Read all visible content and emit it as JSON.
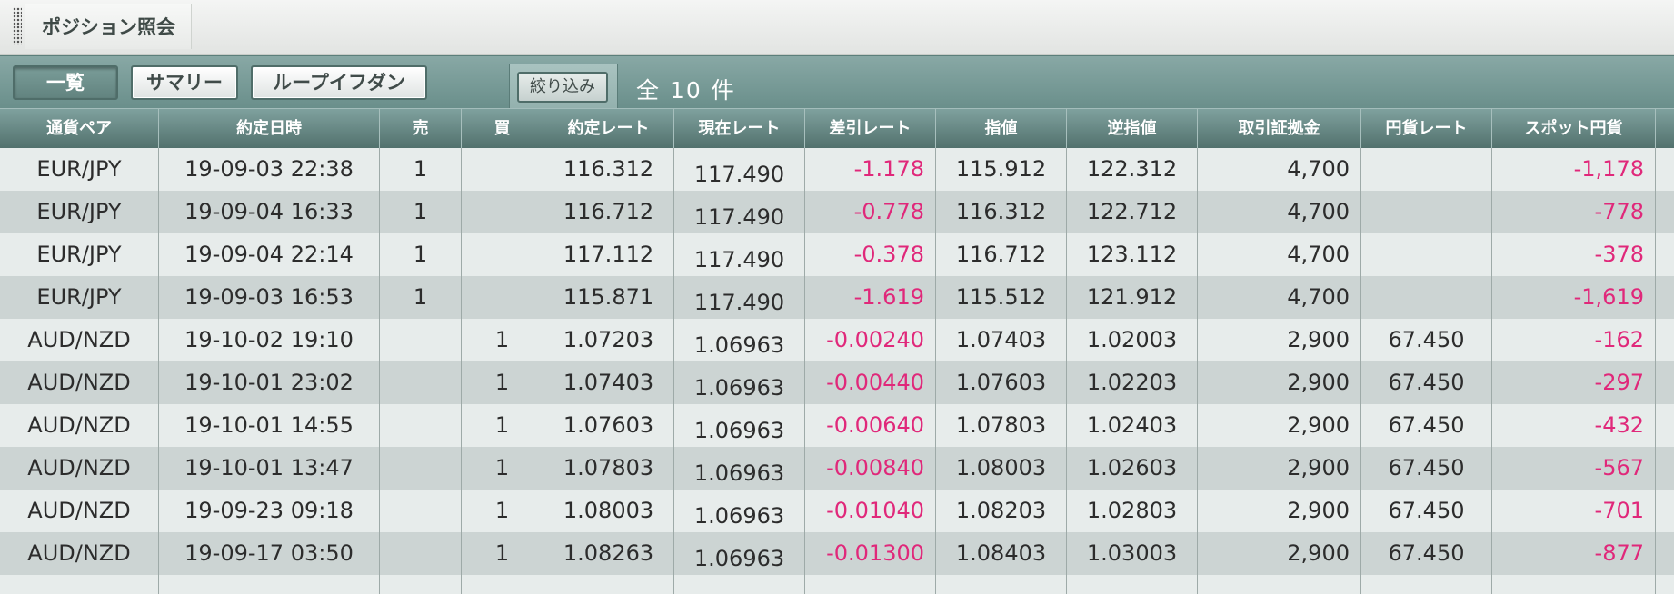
{
  "window": {
    "title": "ポジション照会"
  },
  "toolbar": {
    "buttons": [
      {
        "label": "一覧"
      },
      {
        "label": "サマリー"
      },
      {
        "label": "ループイフダン"
      }
    ],
    "filter_label": "絞り込み",
    "count_label": "全 10 件"
  },
  "table": {
    "columns": [
      "通貨ペア",
      "約定日時",
      "売",
      "買",
      "約定レート",
      "現在レート",
      "差引レート",
      "指値",
      "逆指値",
      "取引証拠金",
      "円貨レート",
      "スポット円貨"
    ],
    "rows": [
      [
        "EUR/JPY",
        "19-09-03 22:38",
        "1",
        "",
        "116.312",
        "117.490",
        "-1.178",
        "115.912",
        "122.312",
        "4,700",
        "",
        "-1,178"
      ],
      [
        "EUR/JPY",
        "19-09-04 16:33",
        "1",
        "",
        "116.712",
        "117.490",
        "-0.778",
        "116.312",
        "122.712",
        "4,700",
        "",
        "-778"
      ],
      [
        "EUR/JPY",
        "19-09-04 22:14",
        "1",
        "",
        "117.112",
        "117.490",
        "-0.378",
        "116.712",
        "123.112",
        "4,700",
        "",
        "-378"
      ],
      [
        "EUR/JPY",
        "19-09-03 16:53",
        "1",
        "",
        "115.871",
        "117.490",
        "-1.619",
        "115.512",
        "121.912",
        "4,700",
        "",
        "-1,619"
      ],
      [
        "AUD/NZD",
        "19-10-02 19:10",
        "",
        "1",
        "1.07203",
        "1.06963",
        "-0.00240",
        "1.07403",
        "1.02003",
        "2,900",
        "67.450",
        "-162"
      ],
      [
        "AUD/NZD",
        "19-10-01 23:02",
        "",
        "1",
        "1.07403",
        "1.06963",
        "-0.00440",
        "1.07603",
        "1.02203",
        "2,900",
        "67.450",
        "-297"
      ],
      [
        "AUD/NZD",
        "19-10-01 14:55",
        "",
        "1",
        "1.07603",
        "1.06963",
        "-0.00640",
        "1.07803",
        "1.02403",
        "2,900",
        "67.450",
        "-432"
      ],
      [
        "AUD/NZD",
        "19-10-01 13:47",
        "",
        "1",
        "1.07803",
        "1.06963",
        "-0.00840",
        "1.08003",
        "1.02603",
        "2,900",
        "67.450",
        "-567"
      ],
      [
        "AUD/NZD",
        "19-09-23 09:18",
        "",
        "1",
        "1.08003",
        "1.06963",
        "-0.01040",
        "1.08203",
        "1.02803",
        "2,900",
        "67.450",
        "-701"
      ],
      [
        "AUD/NZD",
        "19-09-17 03:50",
        "",
        "1",
        "1.08263",
        "1.06963",
        "-0.01300",
        "1.08403",
        "1.03003",
        "2,900",
        "67.450",
        "-877"
      ]
    ]
  },
  "colors": {
    "negative": "#e0287a",
    "header": "#5f807c",
    "row_odd": "#e7eceb",
    "row_even": "#ccd4d3"
  },
  "icons": {
    "grip": "drag-grip-icon"
  }
}
